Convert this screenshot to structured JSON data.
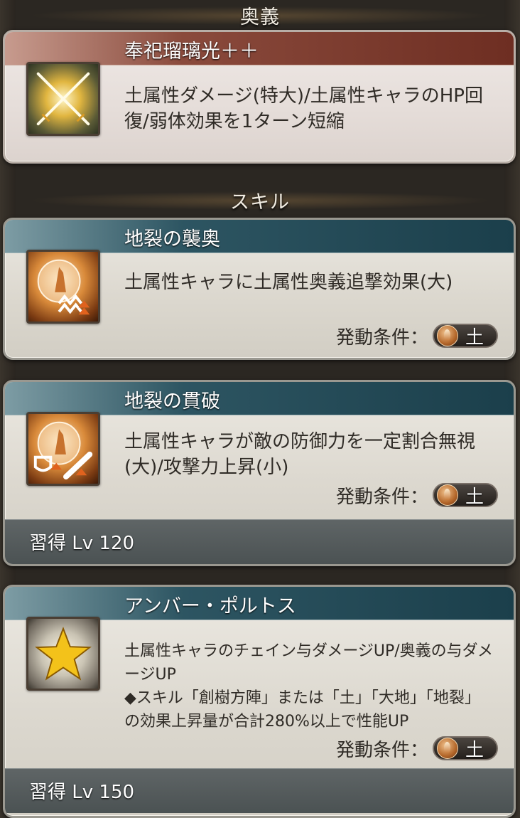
{
  "ougi_section": {
    "heading": "奥義",
    "name": "奉祀瑠璃光＋＋",
    "description": "土属性ダメージ(特大)/土属性キャラのHP回復/弱体効果を1ターン短縮"
  },
  "skill_section": {
    "heading": "スキル"
  },
  "skills": [
    {
      "name": "地裂の襲奥",
      "description": "土属性キャラに土属性奥義追撃効果(大)",
      "condition_label": "発動条件：",
      "condition_element": "土"
    },
    {
      "name": "地裂の貫破",
      "description": "土属性キャラが敵の防御力を一定割合無視(大)/攻撃力上昇(小)",
      "condition_label": "発動条件：",
      "condition_element": "土",
      "learn": "習得 Lv 120"
    },
    {
      "name": "アンバー・ポルトス",
      "description": "土属性キャラのチェイン与ダメージUP/奥義の与ダメージUP",
      "description2": "◆スキル「創樹方陣」または「土」「大地」「地裂」の効果上昇量が合計280%以上で性能UP",
      "condition_label": "発動条件：",
      "condition_element": "土",
      "learn": "習得 Lv 150"
    }
  ],
  "colors": {
    "ougi_bar": "#7a3628",
    "skill_bar": "#1f4652",
    "element_earth": "#b4672a"
  },
  "icons": [
    "crossed-swords-icon",
    "earth-orb-attack-icon",
    "earth-orb-defense-break-icon",
    "gold-star-icon"
  ]
}
